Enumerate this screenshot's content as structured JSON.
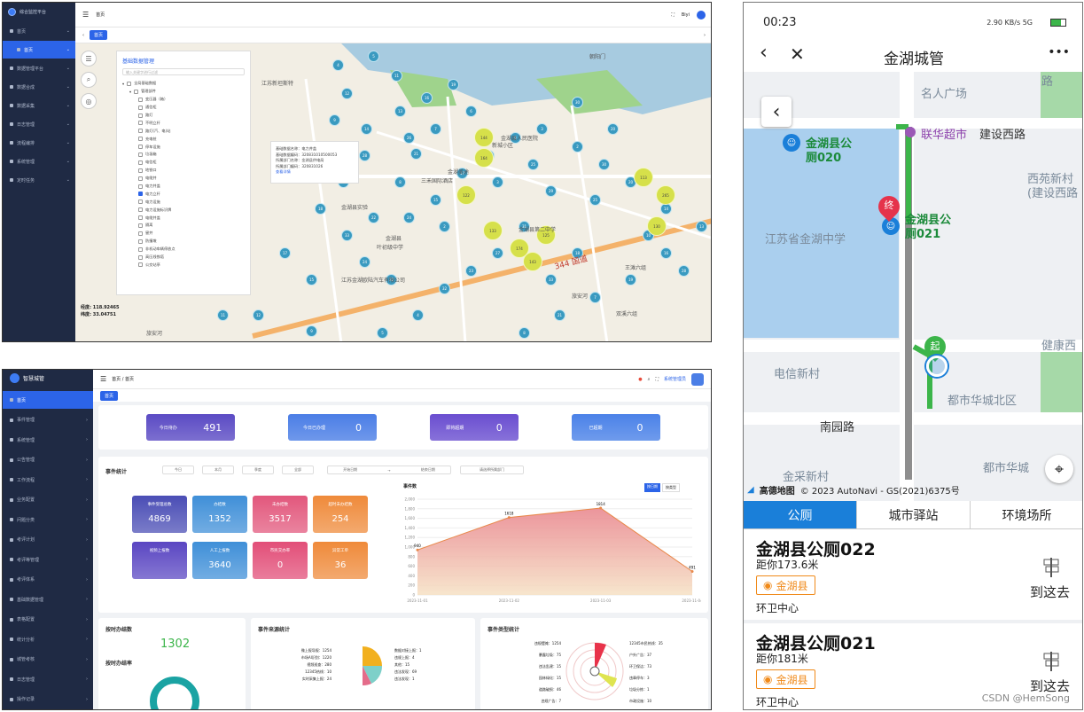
{
  "map_admin": {
    "app_title": "综合监控平台",
    "sidebar": [
      {
        "label": "首页",
        "active": false
      },
      {
        "label": "首页",
        "active": true,
        "sub": true
      },
      {
        "label": "数据管理平台",
        "active": false
      },
      {
        "label": "数据合成",
        "active": false
      },
      {
        "label": "数据采集",
        "active": false
      },
      {
        "label": "日志管理",
        "active": false
      },
      {
        "label": "流程编排",
        "active": false
      },
      {
        "label": "系统管理",
        "active": false
      },
      {
        "label": "定时任务",
        "active": false
      }
    ],
    "breadcrumb": "首页",
    "user": "Biyi",
    "tab": "首页",
    "panel": {
      "title": "基础数据管理",
      "search_placeholder": "输入关键字进行过滤",
      "root": "全局基础数据",
      "group": "管理部件",
      "items": [
        "变压器（箱）",
        "通信柜",
        "路灯",
        "不明立杆",
        "路灯(汽、电)站",
        "充电桩",
        "停车设施",
        "垃圾箱",
        "电信柜",
        "地铁口",
        "电缆井",
        "电力井盖",
        "电力立杆",
        "电力设施",
        "电力设施标识牌",
        "电缆井盖",
        "隔离",
        "窨井",
        "防撞墩",
        "非机动车辆停放点",
        "高压线铁塔",
        "公交站亭"
      ],
      "checked_index": 12
    },
    "popup": {
      "line1": "基础数据名称：电力井盖",
      "line2": "基础数据编码：320831010500053",
      "line3": "所属部门名称：金湖县供电局",
      "line4": "所属部门编码：320831026",
      "link": "查看详情"
    },
    "coords": {
      "lng": "经度: 118.92465",
      "lat": "纬度: 33.04751"
    },
    "map_labels": [
      "江苏新坦斯特",
      "新城小区",
      "金湖县",
      "三禾国际酒店",
      "金湖县第二中学",
      "叶初级中学",
      "江苏金湖欧陆汽车有限公司",
      "金湖县实验",
      "双溪六组",
      "王滩六组",
      "旅安河",
      "旅安河",
      "金湖美途",
      "朝阳门",
      "金湖县人民医院"
    ],
    "road_label": "344 国道",
    "clusters": [
      "4",
      "5",
      "11",
      "12",
      "9",
      "14",
      "13",
      "16",
      "19",
      "7",
      "21",
      "8",
      "28",
      "10",
      "18",
      "33",
      "22",
      "24",
      "15",
      "17",
      "26",
      "6",
      "3",
      "2",
      "30",
      "20",
      "25",
      "29",
      "31",
      "27",
      "23",
      "32"
    ],
    "big_clusters": [
      "144",
      "164",
      "113",
      "265",
      "122",
      "125",
      "133",
      "130",
      "174",
      "143"
    ]
  },
  "dashboard": {
    "app_title": "智慧城管",
    "sidebar": [
      "首页",
      "事件管理",
      "系统管理",
      "公告管理",
      "工作流程",
      "业务配置",
      "问题分类",
      "考评计划",
      "考评等管理",
      "考评体系",
      "基础数据管理",
      "表格配置",
      "统计分析",
      "城管考核",
      "日志管理",
      "操作记录"
    ],
    "breadcrumb": "首页 / 首页",
    "user": "系统管理员",
    "tab": "首页",
    "top_stats": [
      {
        "label": "今日待办",
        "value": "491",
        "color": "#5b4bc4"
      },
      {
        "label": "今日已办理",
        "value": "0",
        "color": "#4b7ee6"
      },
      {
        "label": "即将超期",
        "value": "0",
        "color": "#6a4ed0"
      },
      {
        "label": "已超期",
        "value": "0",
        "color": "#4b82e8"
      }
    ],
    "event_section": "事件统计",
    "filters": [
      "今日",
      "本月",
      "季度",
      "全部"
    ],
    "date_start": "开始日期",
    "date_end": "结束日期",
    "select_placeholder": "请选择所属部门",
    "tiles": [
      {
        "label": "事件受理总数",
        "value": "4869",
        "color": "#4a4db5"
      },
      {
        "label": "办结数",
        "value": "1352",
        "color": "#3f8fd8"
      },
      {
        "label": "未办结数",
        "value": "3517",
        "color": "#e2577c"
      },
      {
        "label": "超时未办结数",
        "value": "254",
        "color": "#ef8a3a"
      },
      {
        "label": "视频上报数",
        "value": "",
        "color": "#5a46c2"
      },
      {
        "label": "人工上报数",
        "value": "3640",
        "color": "#3f8fd8"
      },
      {
        "label": "市民交办率",
        "value": "0",
        "color": "#e24e78"
      },
      {
        "label": "异常工单",
        "value": "36",
        "color": "#ef8a3a"
      }
    ],
    "chart_toggle": [
      "按日期",
      "按类型"
    ],
    "ontime_title": "按时办结数",
    "ontime_value": "1302",
    "ontime_rate_title": "按时办结率",
    "source_title": "事件来源统计",
    "source_labels_left": [
      "微上报导报：1254",
      "市场AI识别：1220",
      "视频巡查：280",
      "12345热线：10",
      "实时采集上报：24"
    ],
    "source_labels_right": [
      "数据对接上报：1",
      "违规上报：4",
      "其他：15",
      "违法发现：69",
      "违法发现：1"
    ],
    "type_title": "事件类型统计",
    "type_labels_left": [
      "违规摆摊：1254",
      "暴露垃圾：75",
      "违法乱建：15",
      "园林绿化：15",
      "道路破损：46",
      "违规广告：7"
    ],
    "type_labels_right": [
      "12345市民热线：35",
      "户外广告：37",
      "环卫保洁：73",
      "违章停车：3",
      "垃圾分拣：1",
      "市政设施：10"
    ]
  },
  "chart_data": {
    "type": "area",
    "title": "事件数",
    "categories": [
      "2023-11-01",
      "2023-11-02",
      "2023-11-03",
      "2023-11-04"
    ],
    "values": [
      940,
      1618,
      1814,
      491
    ],
    "ylim": [
      0,
      2000
    ],
    "yticks": [
      "0",
      "200",
      "400",
      "600",
      "800",
      "1,000",
      "1,200",
      "1,400",
      "1,600",
      "1,800",
      "2,000"
    ],
    "grid": true
  },
  "mobile": {
    "time": "00:23",
    "status_icons": "2.90 KB/s 5G",
    "title": "金湖城管",
    "more": "•••",
    "map_labels": {
      "guangchang": "名人广场",
      "lu": "路",
      "lianhua": "联华超市",
      "jianshe": "建设西路",
      "xiyuan1": "西苑新村",
      "xiyuan2": "(建设西路",
      "school": "江苏省金湖中学",
      "dianxin": "电信新村",
      "dushi": "都市华城北区",
      "nanyuan": "南园路",
      "jincai": "金采新村",
      "dushi2": "都市华城",
      "jiankang": "健康西",
      "toilet1_a": "金湖县公",
      "toilet1_b": "厕020",
      "toilet2_a": "金湖县公",
      "toilet2_b": "厕021",
      "end_marker": "终",
      "start_marker": "起",
      "brand": "高德地图",
      "copyright": "© 2023 AutoNavi - GS(2021)6375号"
    },
    "tabs": [
      {
        "label": "公厕",
        "active": true
      },
      {
        "label": "城市驿站",
        "active": false
      },
      {
        "label": "环境场所",
        "active": false
      }
    ],
    "items": [
      {
        "name": "金湖县公厕022",
        "distance": "距你173.6米",
        "tag": "金湖县",
        "area": "环卫中心",
        "action": "到这去"
      },
      {
        "name": "金湖县公厕021",
        "distance": "距你181米",
        "tag": "金湖县",
        "area": "环卫中心",
        "action": "到这去"
      }
    ],
    "watermark": "CSDN @HemSong"
  },
  "colors": {
    "brand_blue": "#2c64e8",
    "mobile_tab": "#1a7fd9",
    "route_green": "#3cb54a",
    "tag_orange": "#f08a1a"
  }
}
